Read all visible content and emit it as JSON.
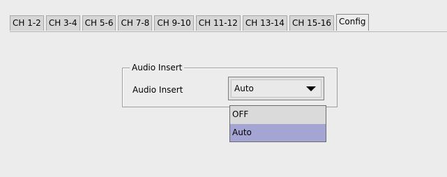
{
  "tabs": [
    {
      "label": "CH 1-2"
    },
    {
      "label": "CH 3-4"
    },
    {
      "label": "CH 5-6"
    },
    {
      "label": "CH 7-8"
    },
    {
      "label": "CH 9-10"
    },
    {
      "label": "CH 11-12"
    },
    {
      "label": "CH 13-14"
    },
    {
      "label": "CH 15-16"
    },
    {
      "label": "Config"
    }
  ],
  "active_tab": "Config",
  "group": {
    "title": "Audio Insert",
    "field_label": "Audio Insert",
    "selected_value": "Auto",
    "options": [
      "OFF",
      "Auto"
    ],
    "highlighted_option": "Auto"
  },
  "colors": {
    "panel_bg": "#ececec",
    "highlight": "#a5a5d3"
  }
}
